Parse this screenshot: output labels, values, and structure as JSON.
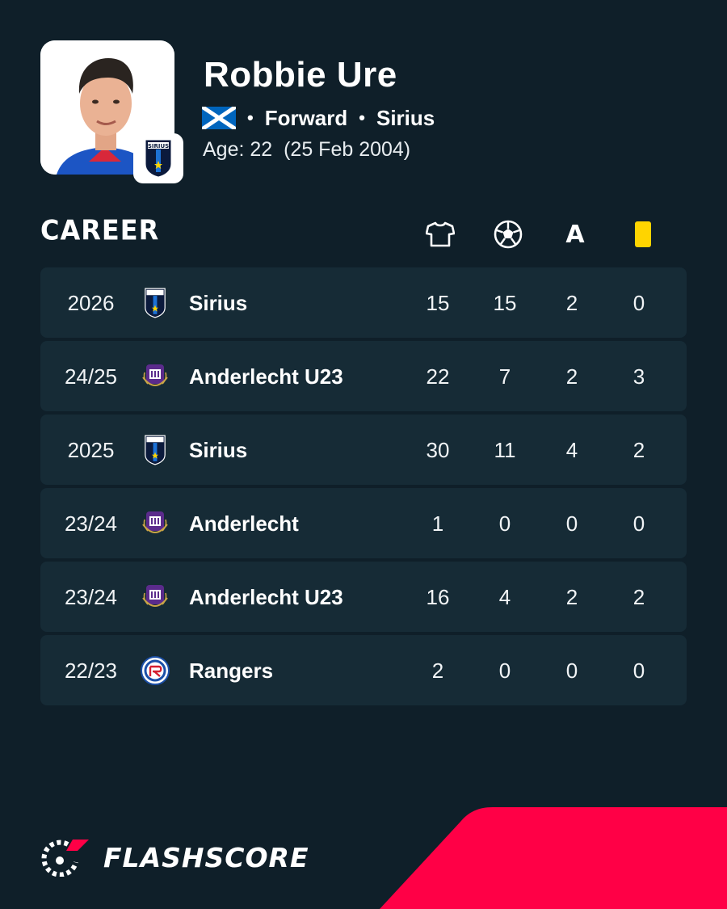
{
  "player": {
    "name": "Robbie Ure",
    "position": "Forward",
    "club": "Sirius",
    "age_label": "Age: 22",
    "birth_date": "(25 Feb 2004)",
    "nationality_icon": "scotland-flag-icon",
    "club_badge_icon": "sirius-badge-icon"
  },
  "career": {
    "title": "CAREER",
    "columns": [
      {
        "icon": "jersey-icon",
        "label": ""
      },
      {
        "icon": "football-icon",
        "label": ""
      },
      {
        "icon": "assist-icon",
        "label": "A"
      },
      {
        "icon": "yellow-card-icon",
        "label": ""
      }
    ],
    "rows": [
      {
        "season": "2026",
        "team": "Sirius",
        "logo": "sirius",
        "apps": "15",
        "goals": "15",
        "assists": "2",
        "yellow": "0"
      },
      {
        "season": "24/25",
        "team": "Anderlecht U23",
        "logo": "anderlecht",
        "apps": "22",
        "goals": "7",
        "assists": "2",
        "yellow": "3"
      },
      {
        "season": "2025",
        "team": "Sirius",
        "logo": "sirius",
        "apps": "30",
        "goals": "11",
        "assists": "4",
        "yellow": "2"
      },
      {
        "season": "23/24",
        "team": "Anderlecht",
        "logo": "anderlecht",
        "apps": "1",
        "goals": "0",
        "assists": "0",
        "yellow": "0"
      },
      {
        "season": "23/24",
        "team": "Anderlecht U23",
        "logo": "anderlecht",
        "apps": "16",
        "goals": "4",
        "assists": "2",
        "yellow": "2"
      },
      {
        "season": "22/23",
        "team": "Rangers",
        "logo": "rangers",
        "apps": "2",
        "goals": "0",
        "assists": "0",
        "yellow": "0"
      }
    ]
  },
  "brand": {
    "name": "FLASHSCORE",
    "accent_color": "#ff0046",
    "background_color": "#0f1f29",
    "row_color": "#162b36",
    "card_color": "#ffd400"
  }
}
